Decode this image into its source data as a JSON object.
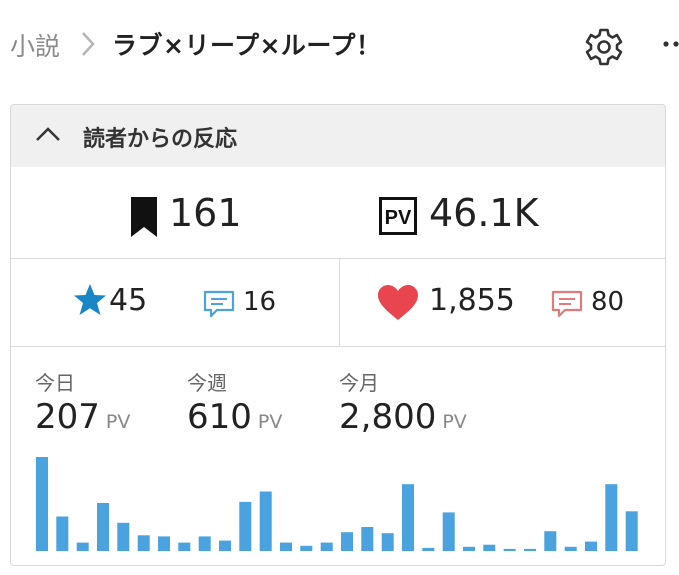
{
  "breadcrumb": {
    "root": "小説",
    "title": "ラブ×リープ×ループ！"
  },
  "card": {
    "title": "読者からの反応",
    "bookmarks": "161",
    "pv_total": "46.1K",
    "pv_badge": "PV",
    "stars": "45",
    "star_comments": "16",
    "hearts": "1,855",
    "heart_comments": "80"
  },
  "stats": {
    "today_label": "今日",
    "today_value": "207",
    "week_label": "今週",
    "week_value": "610",
    "month_label": "今月",
    "month_value": "2,800",
    "unit": "PV"
  },
  "colors": {
    "accent_blue": "#4aa3df",
    "heart_red": "#e8454f",
    "comment_red": "#e07b7b",
    "bar": "#4aa3df"
  },
  "chart_data": {
    "type": "bar",
    "values": [
      90,
      33,
      8,
      46,
      27,
      15,
      14,
      8,
      14,
      10,
      47,
      57,
      8,
      5,
      8,
      18,
      23,
      17,
      64,
      3,
      37,
      4,
      6,
      2,
      2,
      19,
      4,
      9,
      64,
      38
    ]
  }
}
